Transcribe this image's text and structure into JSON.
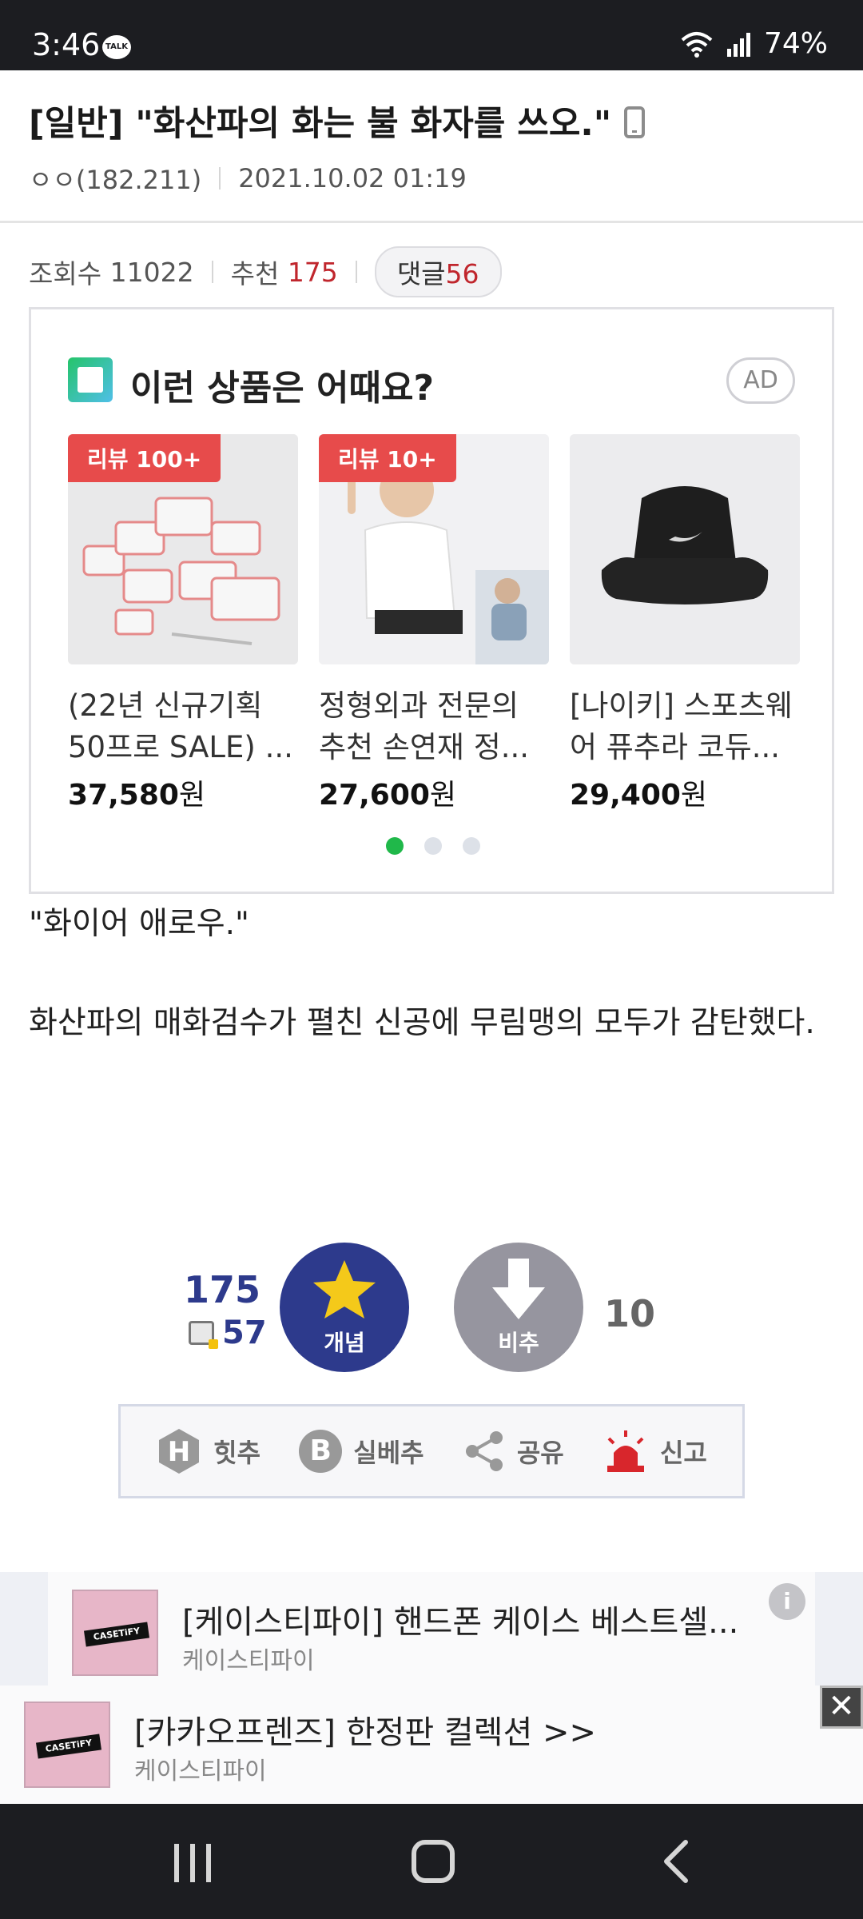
{
  "status_bar": {
    "time": "3:46",
    "talk_badge": "TALK",
    "battery": "74%"
  },
  "post": {
    "title": "[일반] \"화산파의 화는 불 화자를 쓰오.\"",
    "author": "ㅇㅇ(182.211)",
    "datetime": "2021.10.02 01:19",
    "views_label": "조회수",
    "views": "11022",
    "recommend_label": "추천",
    "recommend": "175",
    "comments_label": "댓글",
    "comments": "56",
    "body_lines": [
      "\"화이어 애로우.\"",
      "화산파의 매화검수가 펼친 신공에 무림맹의 모두가 감탄했다."
    ]
  },
  "ad_box": {
    "heading": "이런 상품은 어때요?",
    "ad_tag": "AD",
    "products": [
      {
        "badge": "리뷰 100+",
        "name": "(22년 신규기획 50프로 SALE) ...",
        "price": "37,580",
        "currency": "원"
      },
      {
        "badge": "리뷰 10+",
        "name": "정형외과 전문의 추천 손연재 정...",
        "price": "27,600",
        "currency": "원"
      },
      {
        "badge": "",
        "name": "[나이키] 스포츠웨어 퓨추라 코듀...",
        "price": "29,400",
        "currency": "원"
      }
    ]
  },
  "vote": {
    "up_count": "175",
    "sub_count": "57",
    "up_label": "개념",
    "down_label": "비추",
    "down_count": "10"
  },
  "actions": {
    "hit": "힛추",
    "silbe": "실베추",
    "share": "공유",
    "report": "신고"
  },
  "banner_ads": [
    {
      "title": "[케이스티파이] 핸드폰 케이스 베스트셀...",
      "sub": "케이스티파이",
      "thumb_text": "CASETiFY"
    },
    {
      "title": "[카카오프렌즈] 한정판 컬렉션 >>",
      "sub": "케이스티파이",
      "thumb_text": "CASETiFY"
    }
  ],
  "colors": {
    "accent_blue": "#2d3a8c",
    "accent_red": "#c0262d",
    "badge_red": "#e74b4b",
    "dot_active": "#20b84a"
  }
}
